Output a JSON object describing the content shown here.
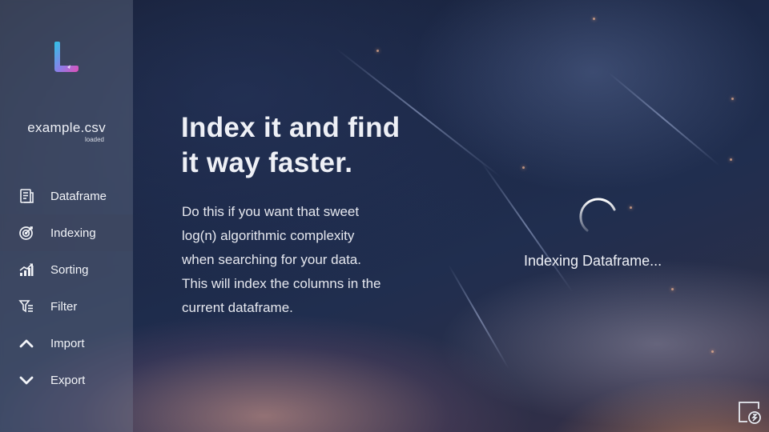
{
  "file": {
    "name": "example.csv",
    "status": "loaded"
  },
  "nav": [
    {
      "label": "Dataframe",
      "icon": "dataframe-icon"
    },
    {
      "label": "Indexing",
      "icon": "target-icon"
    },
    {
      "label": "Sorting",
      "icon": "chart-icon"
    },
    {
      "label": "Filter",
      "icon": "filter-icon"
    },
    {
      "label": "Import",
      "icon": "chevron-up-icon"
    },
    {
      "label": "Export",
      "icon": "chevron-down-icon"
    }
  ],
  "main": {
    "headline_1": "Index it and find",
    "headline_2": "it way faster.",
    "description": [
      "Do this if you want that sweet",
      "log(n) algorithmic complexity",
      "when searching for your data.",
      "This will index the columns in the",
      "current dataframe."
    ]
  },
  "loading": {
    "status": "Indexing Dataframe..."
  },
  "colors": {
    "accent_start": "#2ec4e6",
    "accent_end": "#e14fb8"
  }
}
